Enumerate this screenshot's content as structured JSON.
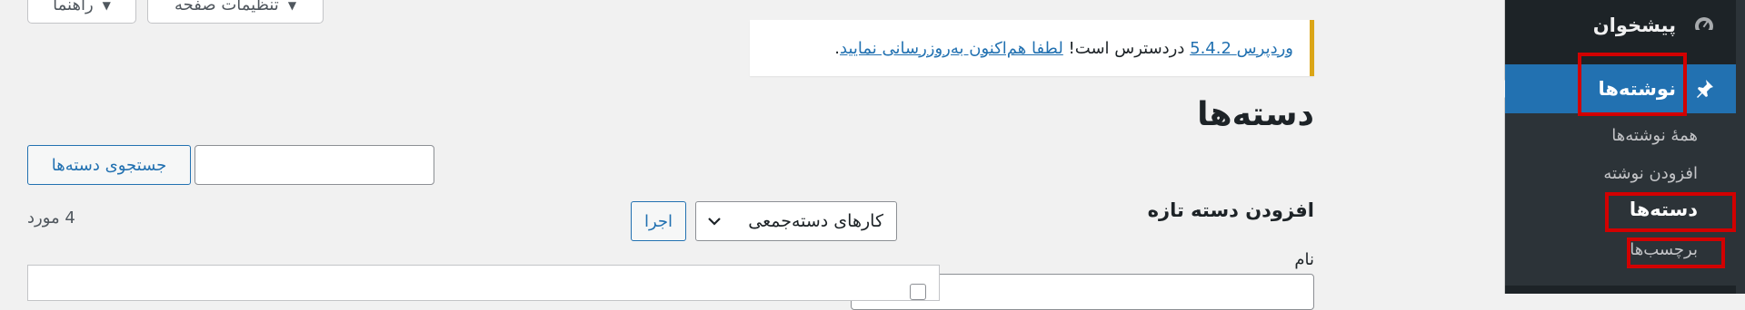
{
  "screen_meta": {
    "screen_options": "تنظیمات صفحه",
    "help": "راهنما"
  },
  "sidebar": {
    "dashboard": "پیشخوان",
    "posts": "نوشته‌ها",
    "submenu": {
      "all_posts": "همهٔ نوشته‌ها",
      "add_new": "افزودن نوشته",
      "categories": "دسته‌ها",
      "tags": "برچسب‌ها"
    }
  },
  "notice": {
    "wordpress": "وردپرس",
    "version": "5.4.2",
    "available": "دردسترس است!",
    "update_link": "لطفا هم‌اکنون به‌روزرسانی نمایید",
    "period": "."
  },
  "page": {
    "title": "دسته‌ها",
    "add_new_title": "افزودن دسته تازه",
    "name_label": "نام"
  },
  "search": {
    "button": "جستجوی دسته‌ها",
    "value": ""
  },
  "bulk": {
    "select_value": "کارهای دسته‌جمعی",
    "apply": "اجرا"
  },
  "item_count": "4 مورد",
  "colors": {
    "sidebar_bg": "#1d2327",
    "active": "#2271b1",
    "notice_border": "#dba617",
    "highlight": "#d20000"
  },
  "icons": {
    "dashboard": "gauge-icon",
    "posts": "pin-icon",
    "select": "chevron-down-icon",
    "screen_options": "caret-down-icon"
  }
}
